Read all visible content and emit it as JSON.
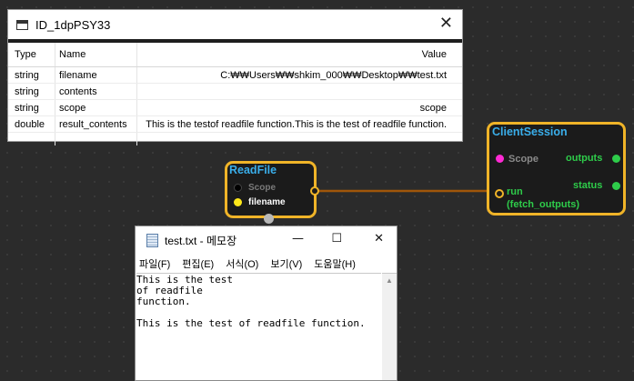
{
  "property_window": {
    "title": "ID_1dpPSY33",
    "close_glyph": "✕",
    "columns": [
      "Type",
      "Name",
      "Value"
    ],
    "rows": [
      {
        "type": "string",
        "name": "filename",
        "value": "C:₩₩Users₩₩shkim_000₩₩Desktop₩₩test.txt"
      },
      {
        "type": "string",
        "name": "contents",
        "value": ""
      },
      {
        "type": "string",
        "name": "scope",
        "value": "scope"
      },
      {
        "type": "double",
        "name": "result_contents",
        "value": "This is the testof readfile function.This is the test of readfile function."
      }
    ]
  },
  "readfile_node": {
    "title": "ReadFile",
    "pins": {
      "scope": "Scope",
      "filename": "filename"
    }
  },
  "client_session_node": {
    "title": "ClientSession",
    "pins": {
      "scope": "Scope",
      "outputs": "outputs",
      "status": "status",
      "run": "run",
      "run_sub": "(fetch_outputs)"
    }
  },
  "notepad": {
    "title": "test.txt - 메모장",
    "controls": {
      "minimize": "—",
      "maximize": "☐",
      "close": "✕"
    },
    "menu": [
      "파일(F)",
      "편집(E)",
      "서식(O)",
      "보기(V)",
      "도움말(H)"
    ],
    "content": "This is the test\nof readfile\nfunction.\n\nThis is the test of readfile function.",
    "scroll_up_glyph": "▲"
  },
  "colors": {
    "node_border": "#f0b428",
    "node_title": "#3aaeea",
    "pin_green": "#2ecc4a",
    "pin_magenta": "#ff2ad4",
    "pin_yellow": "#ffe81a",
    "wire": "#a0560a"
  }
}
